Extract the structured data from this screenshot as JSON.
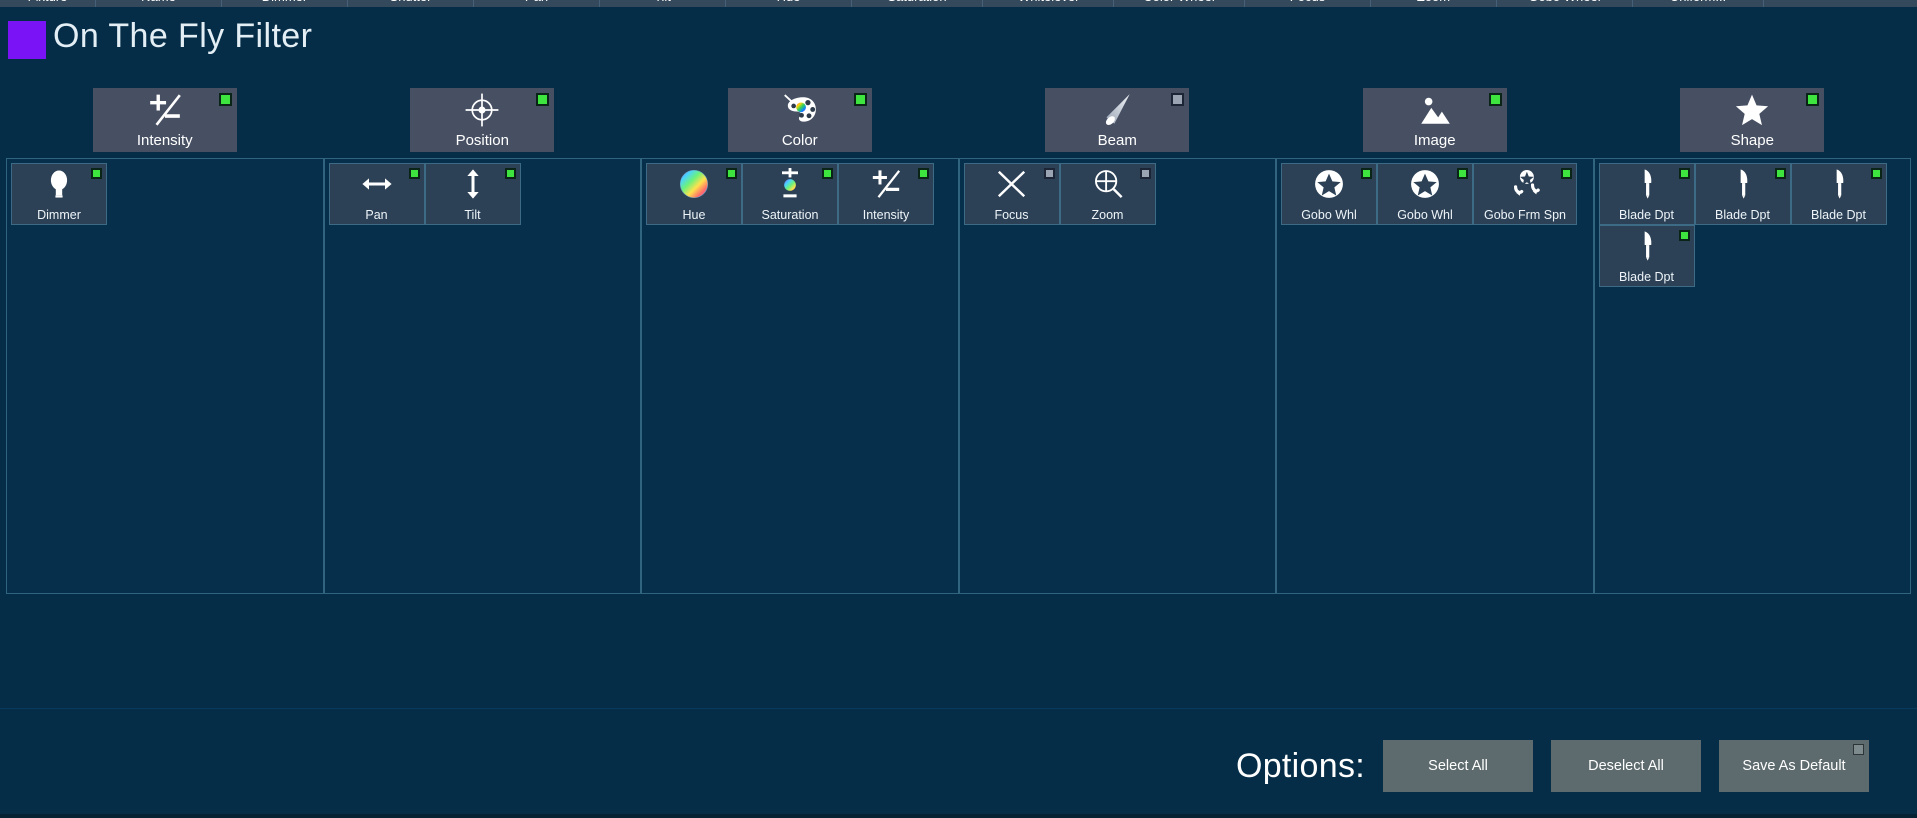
{
  "window": {
    "title": "On The Fly Filter",
    "swatch_color": "#7a13f5",
    "background_color": "#052d47"
  },
  "top_column_headers": [
    "Fixture",
    "Name",
    "Dimmer",
    "Shutter",
    "Pan",
    "Tilt",
    "Hue",
    "Saturation",
    "Whitelevel",
    "Color Wheel",
    "Focus",
    "Zoom",
    "Gobo Wheel",
    "Uniform..."
  ],
  "groups": [
    {
      "id": "intensity",
      "label": "Intensity",
      "icon": "plus-minus-slash-icon",
      "selected": true,
      "attributes": [
        {
          "label": "Dimmer",
          "icon": "lightbulb-icon",
          "selected": true
        }
      ]
    },
    {
      "id": "position",
      "label": "Position",
      "icon": "crosshair-target-icon",
      "selected": true,
      "attributes": [
        {
          "label": "Pan",
          "icon": "left-right-arrow-icon",
          "selected": true
        },
        {
          "label": "Tilt",
          "icon": "up-down-arrow-icon",
          "selected": true
        }
      ]
    },
    {
      "id": "color",
      "label": "Color",
      "icon": "paint-palette-icon",
      "selected": true,
      "attributes": [
        {
          "label": "Hue",
          "icon": "color-wheel-icon",
          "selected": true
        },
        {
          "label": "Saturation",
          "icon": "saturation-icon",
          "selected": true
        },
        {
          "label": "Intensity",
          "icon": "plus-minus-slash-icon",
          "selected": true
        }
      ]
    },
    {
      "id": "beam",
      "label": "Beam",
      "icon": "light-beam-cone-icon",
      "selected": false,
      "attributes": [
        {
          "label": "Focus",
          "icon": "focus-crossing-lines-icon",
          "selected": false
        },
        {
          "label": "Zoom",
          "icon": "magnifier-plus-icon",
          "selected": false
        }
      ]
    },
    {
      "id": "image",
      "label": "Image",
      "icon": "picture-mountain-icon",
      "selected": true,
      "attributes": [
        {
          "label": "Gobo Whl",
          "icon": "gobo-star-icon",
          "selected": true
        },
        {
          "label": "Gobo Whl",
          "icon": "gobo-star-icon",
          "selected": true
        },
        {
          "label": "Gobo Frm Spn",
          "icon": "gobo-frame-spin-icon",
          "selected": true
        }
      ]
    },
    {
      "id": "shape",
      "label": "Shape",
      "icon": "star-icon",
      "selected": true,
      "attributes": [
        {
          "label": "Blade Dpt",
          "icon": "blade-icon",
          "selected": true
        },
        {
          "label": "Blade Dpt",
          "icon": "blade-icon",
          "selected": true
        },
        {
          "label": "Blade Dpt",
          "icon": "blade-icon",
          "selected": true
        },
        {
          "label": "Blade Dpt",
          "icon": "blade-icon",
          "selected": true
        }
      ]
    }
  ],
  "options": {
    "label": "Options:",
    "buttons": [
      {
        "id": "select-all",
        "label": "Select All",
        "has_checkbox": false
      },
      {
        "id": "deselect-all",
        "label": "Deselect All",
        "has_checkbox": false
      },
      {
        "id": "save-as-default",
        "label": "Save As Default",
        "has_checkbox": true
      }
    ]
  },
  "colors": {
    "accent_purple": "#7a13f5",
    "led_on": "#3fe53f",
    "led_off": "#9aa4b2",
    "tile_bg": "#2c4156",
    "panel_border": "#31647f",
    "cat_tile_bg": "#475063",
    "button_bg": "#5d6a6e"
  }
}
